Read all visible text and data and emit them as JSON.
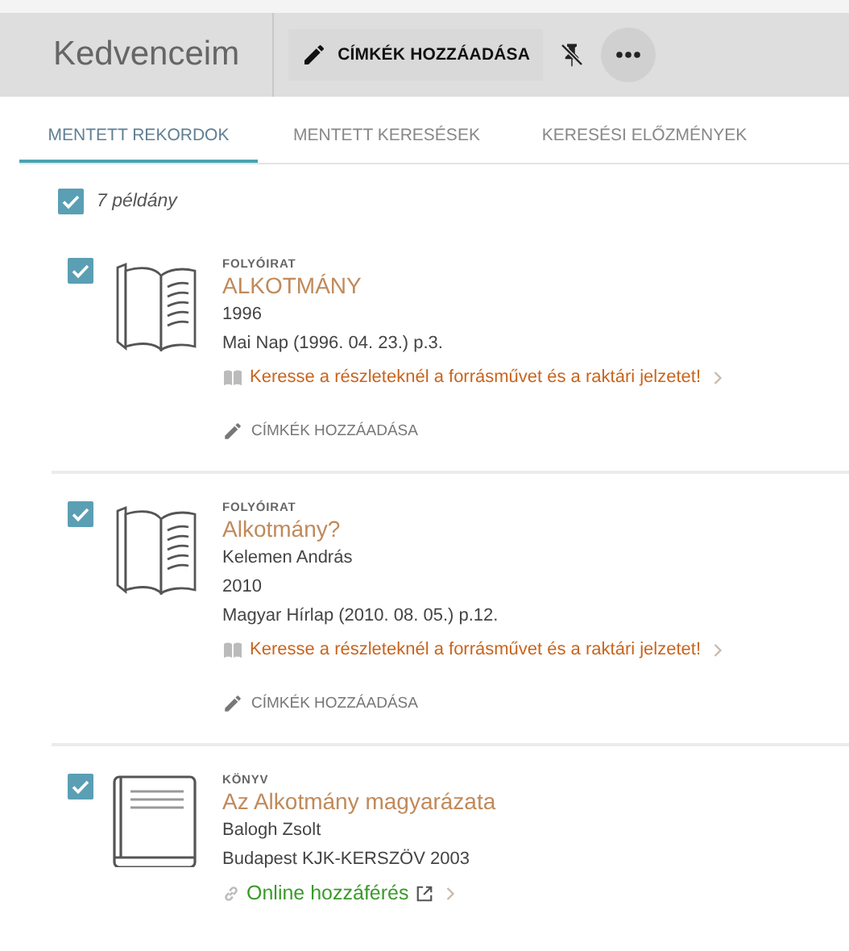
{
  "header": {
    "title": "Kedvenceim",
    "actions": [
      {
        "kind": "tag-button",
        "label": "CÍMKÉK HOZZÁADÁSA"
      },
      {
        "kind": "unpin"
      },
      {
        "kind": "more"
      }
    ]
  },
  "tabs": [
    {
      "label": "MENTETT REKORDOK",
      "selected": true
    },
    {
      "label": "MENTETT KERESÉSEK",
      "selected": false
    },
    {
      "label": "KERESÉSI ELŐZMÉNYEK",
      "selected": false
    }
  ],
  "select_all": {
    "checked": true,
    "label": "7 példány"
  },
  "records": [
    {
      "kind": "journal",
      "checked": true,
      "type_label": "FOLYÓIRAT",
      "title": "ALKOTMÁNY",
      "lines": [
        "1996",
        "Mai Nap (1996. 04. 23.) p.3."
      ],
      "link": {
        "kind": "availability",
        "text": "Keresse a részleteknél a forrásművet és a raktári jelzetet!",
        "external": false
      },
      "tag_button": "CÍMKÉK HOZZÁADÁSA"
    },
    {
      "kind": "journal",
      "checked": true,
      "type_label": "FOLYÓIRAT",
      "title": "Alkotmány?",
      "lines": [
        "Kelemen András",
        "2010",
        "Magyar Hírlap (2010. 08. 05.) p.12."
      ],
      "link": {
        "kind": "availability",
        "text": "Keresse a részleteknél a forrásművet és a raktári jelzetet!",
        "external": false
      },
      "tag_button": "CÍMKÉK HOZZÁADÁSA"
    },
    {
      "kind": "book",
      "checked": true,
      "type_label": "KÖNYV",
      "title": "Az Alkotmány magyarázata",
      "lines": [
        "Balogh Zsolt",
        "Budapest KJK-KERSZÖV 2003"
      ],
      "link": {
        "kind": "online",
        "text": "Online hozzáférés",
        "external": true
      }
    }
  ]
}
